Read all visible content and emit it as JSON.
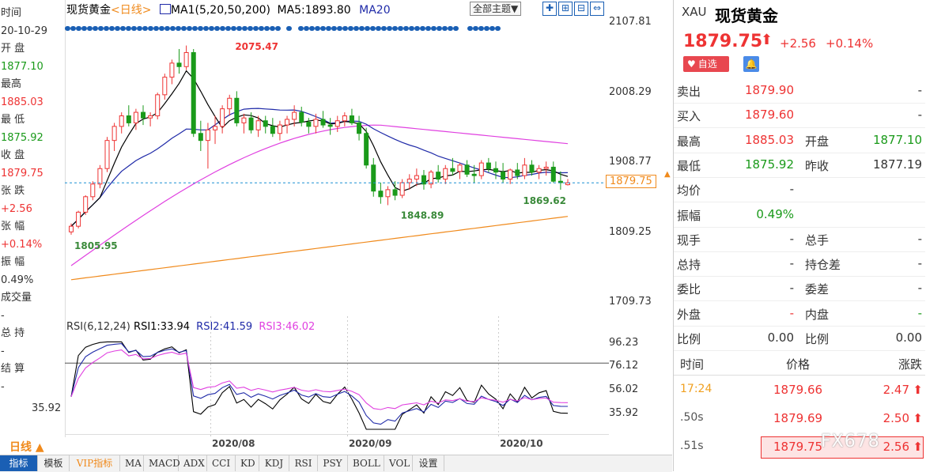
{
  "left_info": [
    {
      "text": "时间",
      "cls": "lbl"
    },
    {
      "text": "20-10-29",
      "cls": "lbl"
    },
    {
      "text": "开 盘",
      "cls": "lbl"
    },
    {
      "text": "1877.10",
      "cls": "green"
    },
    {
      "text": "最高",
      "cls": "lbl"
    },
    {
      "text": "1885.03",
      "cls": "red"
    },
    {
      "text": "最 低",
      "cls": "lbl"
    },
    {
      "text": "1875.92",
      "cls": "green"
    },
    {
      "text": "收 盘",
      "cls": "lbl"
    },
    {
      "text": "1879.75",
      "cls": "red"
    },
    {
      "text": "张 跌",
      "cls": "lbl"
    },
    {
      "text": "+2.56",
      "cls": "red"
    },
    {
      "text": "张 幅",
      "cls": "lbl"
    },
    {
      "text": "+0.14%",
      "cls": "red"
    },
    {
      "text": "振 幅",
      "cls": "lbl"
    },
    {
      "text": "0.49%",
      "cls": "lbl"
    },
    {
      "text": "成交量",
      "cls": "lbl"
    },
    {
      "text": "-",
      "cls": "lbl"
    },
    {
      "text": "总 持",
      "cls": "lbl"
    },
    {
      "text": "-",
      "cls": "lbl"
    },
    {
      "text": "结 算",
      "cls": "lbl"
    },
    {
      "text": "-",
      "cls": "lbl"
    }
  ],
  "left_bottom_value": "35.92",
  "header": {
    "title": "现货黄金",
    "period": "<日线>",
    "ma_label": "MA1(5,20,50,200)",
    "ma5_label": "MA5:1893.80",
    "ma20_label": "MA20",
    "theme_button": "全部主题▼"
  },
  "rsi_header": {
    "label": "RSI(6,12,24)",
    "rsi1": "RSI1:33.94",
    "rsi2": "RSI2:41.59",
    "rsi3": "RSI3:46.02"
  },
  "chart_data": {
    "type": "candlestick",
    "title": "现货黄金",
    "y_ticks": [
      2107.81,
      2008.29,
      1908.77,
      1809.25,
      1709.73
    ],
    "ylim": [
      1690,
      2115
    ],
    "rsi_ticks": [
      96.23,
      76.12,
      56.02,
      35.92
    ],
    "rsi_lim": [
      20,
      100
    ],
    "x_ticks": [
      "2020/08",
      "2020/09",
      "2020/10"
    ],
    "x_tick_index": [
      20,
      39,
      60
    ],
    "current_price_label": "1879.75",
    "current_price": 1879.75,
    "annotations": [
      {
        "text": "2075.47",
        "index": 23,
        "price": 2075.47
      },
      {
        "text": "1805.95",
        "index": 0,
        "price": 1805.95
      },
      {
        "text": "1848.89",
        "index": 46,
        "price": 1848.89
      },
      {
        "text": "1869.62",
        "index": 69,
        "price": 1869.62
      }
    ],
    "candles": [
      [
        1810,
        1822,
        1806,
        1818
      ],
      [
        1818,
        1840,
        1815,
        1838
      ],
      [
        1838,
        1862,
        1834,
        1860
      ],
      [
        1860,
        1882,
        1855,
        1878
      ],
      [
        1878,
        1905,
        1872,
        1900
      ],
      [
        1900,
        1945,
        1895,
        1940
      ],
      [
        1940,
        1965,
        1925,
        1960
      ],
      [
        1960,
        1980,
        1950,
        1975
      ],
      [
        1975,
        1990,
        1960,
        1965
      ],
      [
        1965,
        1985,
        1955,
        1980
      ],
      [
        1980,
        1990,
        1962,
        1972
      ],
      [
        1972,
        1980,
        1960,
        1975
      ],
      [
        1975,
        2008,
        1970,
        2005
      ],
      [
        2005,
        2035,
        1998,
        2030
      ],
      [
        2030,
        2055,
        2020,
        2050
      ],
      [
        2050,
        2070,
        2035,
        2045
      ],
      [
        2045,
        2075,
        2040,
        2065
      ],
      [
        2065,
        2070,
        1945,
        1950
      ],
      [
        1950,
        1968,
        1925,
        1940
      ],
      [
        1940,
        1965,
        1900,
        1955
      ],
      [
        1955,
        1975,
        1935,
        1960
      ],
      [
        1960,
        1990,
        1950,
        1985
      ],
      [
        1985,
        2005,
        1975,
        2000
      ],
      [
        2000,
        2010,
        1960,
        1965
      ],
      [
        1965,
        1978,
        1950,
        1972
      ],
      [
        1972,
        1980,
        1950,
        1955
      ],
      [
        1955,
        1975,
        1945,
        1968
      ],
      [
        1968,
        1975,
        1950,
        1960
      ],
      [
        1960,
        1972,
        1945,
        1950
      ],
      [
        1950,
        1968,
        1940,
        1962
      ],
      [
        1962,
        1975,
        1950,
        1970
      ],
      [
        1970,
        1990,
        1960,
        1980
      ],
      [
        1980,
        1988,
        1960,
        1966
      ],
      [
        1966,
        1972,
        1950,
        1960
      ],
      [
        1960,
        1978,
        1950,
        1970
      ],
      [
        1970,
        1982,
        1958,
        1962
      ],
      [
        1962,
        1972,
        1948,
        1960
      ],
      [
        1960,
        1975,
        1952,
        1968
      ],
      [
        1968,
        1980,
        1960,
        1975
      ],
      [
        1975,
        1985,
        1962,
        1965
      ],
      [
        1965,
        1975,
        1940,
        1950
      ],
      [
        1950,
        1958,
        1900,
        1905
      ],
      [
        1905,
        1915,
        1860,
        1868
      ],
      [
        1868,
        1880,
        1850,
        1860
      ],
      [
        1860,
        1875,
        1848,
        1870
      ],
      [
        1870,
        1882,
        1855,
        1862
      ],
      [
        1862,
        1885,
        1858,
        1880
      ],
      [
        1880,
        1892,
        1870,
        1885
      ],
      [
        1885,
        1900,
        1875,
        1890
      ],
      [
        1890,
        1898,
        1870,
        1878
      ],
      [
        1878,
        1898,
        1872,
        1895
      ],
      [
        1895,
        1905,
        1880,
        1885
      ],
      [
        1885,
        1905,
        1878,
        1900
      ],
      [
        1900,
        1915,
        1890,
        1896
      ],
      [
        1896,
        1908,
        1885,
        1905
      ],
      [
        1905,
        1912,
        1888,
        1892
      ],
      [
        1892,
        1905,
        1880,
        1890
      ],
      [
        1890,
        1912,
        1885,
        1908
      ],
      [
        1908,
        1915,
        1895,
        1900
      ],
      [
        1900,
        1910,
        1885,
        1895
      ],
      [
        1895,
        1908,
        1880,
        1885
      ],
      [
        1885,
        1900,
        1878,
        1898
      ],
      [
        1898,
        1908,
        1885,
        1890
      ],
      [
        1890,
        1915,
        1885,
        1905
      ],
      [
        1905,
        1912,
        1890,
        1895
      ],
      [
        1895,
        1905,
        1885,
        1900
      ],
      [
        1900,
        1910,
        1890,
        1902
      ],
      [
        1902,
        1910,
        1880,
        1882
      ],
      [
        1882,
        1896,
        1870,
        1880
      ],
      [
        1877.1,
        1885.03,
        1875.92,
        1879.75
      ]
    ]
  },
  "quote": {
    "symbol": "XAU",
    "name": "现货黄金",
    "price": "1879.75",
    "arrow": "⬆",
    "change": "+2.56",
    "change_pct": "+0.14%",
    "fav_label": "自选",
    "rows": [
      {
        "l1": "卖出",
        "v1": "1879.90",
        "c1": "red",
        "l2": "",
        "v2": "-",
        "c2": "lbl"
      },
      {
        "l1": "买入",
        "v1": "1879.60",
        "c1": "red",
        "l2": "",
        "v2": "-",
        "c2": "lbl"
      },
      {
        "l1": "最高",
        "v1": "1885.03",
        "c1": "red",
        "l2": "开盘",
        "v2": "1877.10",
        "c2": "green"
      },
      {
        "l1": "最低",
        "v1": "1875.92",
        "c1": "green",
        "l2": "昨收",
        "v2": "1877.19",
        "c2": "lbl"
      },
      {
        "l1": "均价",
        "v1": "-",
        "c1": "lbl",
        "l2": "",
        "v2": "",
        "c2": "lbl"
      },
      {
        "l1": "振幅",
        "v1": "0.49%",
        "c1": "green",
        "l2": "",
        "v2": "",
        "c2": "lbl"
      },
      {
        "l1": "现手",
        "v1": "-",
        "c1": "lbl",
        "l2": "总手",
        "v2": "-",
        "c2": "lbl"
      },
      {
        "l1": "总持",
        "v1": "-",
        "c1": "lbl",
        "l2": "持仓差",
        "v2": "-",
        "c2": "lbl"
      },
      {
        "l1": "委比",
        "v1": "-",
        "c1": "lbl",
        "l2": "委差",
        "v2": "-",
        "c2": "lbl"
      },
      {
        "l1": "外盘",
        "v1": "-",
        "c1": "red",
        "l2": "内盘",
        "v2": "-",
        "c2": "green"
      },
      {
        "l1": "比例",
        "v1": "0.00",
        "c1": "lbl",
        "l2": "比例",
        "v2": "0.00",
        "c2": "lbl"
      }
    ],
    "ticks_header": {
      "time": "时间",
      "price": "价格",
      "change": "涨跌"
    },
    "ticks": [
      {
        "time": "17:24",
        "price": "1879.66",
        "change": "2.47",
        "arrow": "⬆"
      },
      {
        "time": ".50s",
        "price": "1879.69",
        "change": "2.50",
        "arrow": "⬆"
      },
      {
        "time": ".51s",
        "price": "1879.75",
        "change": "2.56",
        "arrow": "⬆"
      }
    ],
    "watermark": "FX678"
  },
  "period_button": "日线 ▲",
  "toolbar": [
    "指标",
    "模板",
    "VIP指标",
    "MA",
    "MACD",
    "ADX",
    "CCI",
    "KD",
    "KDJ",
    "RSI",
    "PSY",
    "BOLL",
    "VOL",
    "设置"
  ],
  "colors": {
    "up": "#e33",
    "down": "#1a9a1a",
    "ma5": "#000000",
    "ma20": "#1f2aa8",
    "ma50": "#e040e0",
    "ma200": "#f08a1c",
    "blue": "#1a5fb4"
  }
}
